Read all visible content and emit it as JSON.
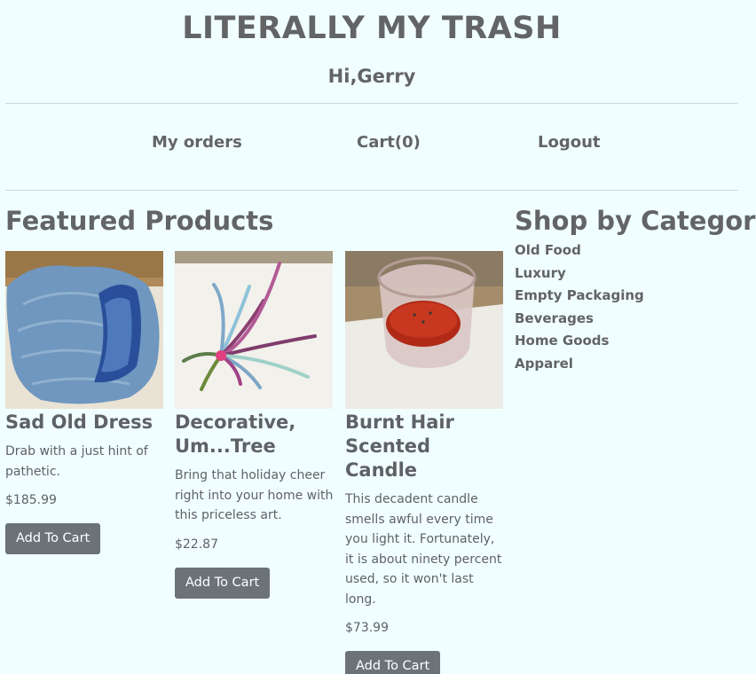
{
  "header": {
    "site_title": "LITERALLY MY TRASH",
    "greeting": "Hi,Gerry"
  },
  "nav": {
    "orders": "My orders",
    "cart": "Cart(0)",
    "logout": "Logout"
  },
  "featured": {
    "title": "Featured Products",
    "products": [
      {
        "name": "Sad Old Dress",
        "description": "Drab with a just hint of pathetic.",
        "price": "$185.99",
        "button": "Add To Cart",
        "image": "blue-dress-photo"
      },
      {
        "name": "Decorative, Um...Tree",
        "description": "Bring that holiday cheer right into your home with this priceless art.",
        "price": "$22.87",
        "button": "Add To Cart",
        "image": "pipe-cleaner-tree-photo"
      },
      {
        "name": "Burnt Hair Scented Candle",
        "description": "This decadent candle smells awful every time you light it. Fortunately, it is about ninety percent used, so it won't last long.",
        "price": "$73.99",
        "button": "Add To Cart",
        "image": "candle-photo"
      }
    ]
  },
  "categories": {
    "title": "Shop by Category:",
    "items": [
      "Old Food",
      "Luxury",
      "Empty Packaging",
      "Beverages",
      "Home Goods",
      "Apparel"
    ]
  },
  "colors": {
    "background": "#f1feff",
    "text": "#626466",
    "button": "#6b7278",
    "button_text": "#ffffff"
  }
}
